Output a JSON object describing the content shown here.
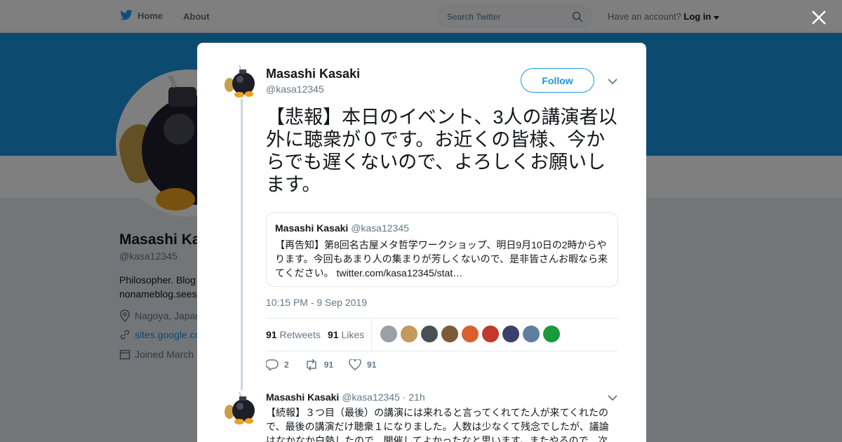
{
  "nav": {
    "home": "Home",
    "about": "About",
    "search_placeholder": "Search Twitter",
    "account_prompt": "Have an account?",
    "login": "Log in"
  },
  "profile": {
    "name": "Masashi Ka",
    "handle": "@kasa12345",
    "bio_line1": "Philosopher. Blog",
    "bio_line2": "nonameblog.sees",
    "location": "Nagoya, Japan",
    "website": "sites.google.co",
    "joined": "Joined March"
  },
  "tweet": {
    "author_name": "Masashi Kasaki",
    "author_handle": "@kasa12345",
    "follow_label": "Follow",
    "text": "【悲報】本日のイベント、3人の講演者以外に聴衆が０です。お近くの皆様、今からでも遅くないので、よろしくお願いします。",
    "quote": {
      "author_name": "Masashi Kasaki",
      "author_handle": "@kasa12345",
      "text": "【再告知】第8回名古屋メタ哲学ワークショップ、明日9月10日の2時からやります。今回もあまり人の集まりが芳しくないので、是非皆さんお暇なら来てください。 twitter.com/kasa12345/stat…"
    },
    "timestamp": "10:15 PM - 9 Sep 2019",
    "retweets_count": "91",
    "retweets_label": "Retweets",
    "likes_count": "91",
    "likes_label": "Likes",
    "actions": {
      "replies": "2",
      "retweets": "91",
      "likes": "91"
    }
  },
  "reply": {
    "author_name": "Masashi Kasaki",
    "author_handle": "@kasa12345",
    "separator": "·",
    "age": "21h",
    "text": "【続報】３つ目（最後）の講演には来れると言ってくれてた人が来てくれたので、最後の講演だけ聴衆１になりました。人数は少なくて残念でしたが、議論はなかなか白熱したので、開催してよかったなと思います。またやるので、次"
  },
  "likers": [
    {
      "color": "#9aa0a6"
    },
    {
      "color": "#c49a5c"
    },
    {
      "color": "#4a4f55"
    },
    {
      "color": "#7b5b3a"
    },
    {
      "color": "#d9602c"
    },
    {
      "color": "#c0392b"
    },
    {
      "color": "#3b3f6b"
    },
    {
      "color": "#5f7fa0"
    },
    {
      "color": "#1a9a3a"
    }
  ],
  "colors": {
    "accent": "#1b95e0",
    "banner": "#1b95e0"
  }
}
